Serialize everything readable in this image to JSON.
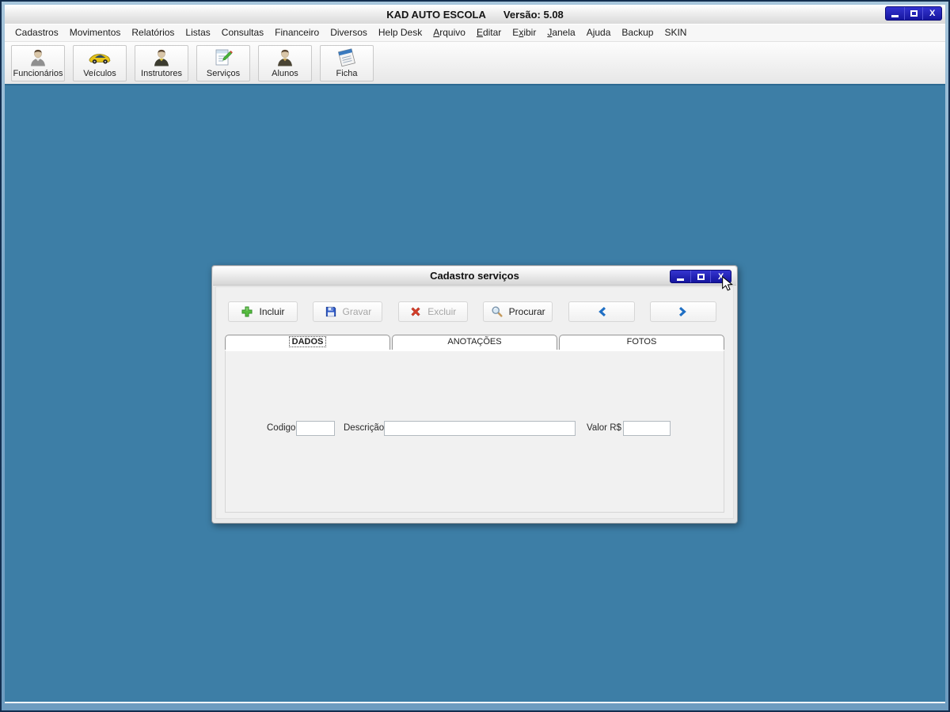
{
  "app": {
    "name": "KAD AUTO ESCOLA",
    "version_label": "Versão: 5.08",
    "window_controls": {
      "minimize_icon": "minimize-icon",
      "maximize_icon": "maximize-icon",
      "close_glyph": "X"
    }
  },
  "menu": {
    "items": [
      {
        "label": "Cadastros"
      },
      {
        "label": "Movimentos"
      },
      {
        "label": "Relatórios"
      },
      {
        "label": "Listas"
      },
      {
        "label": "Consultas"
      },
      {
        "label": "Financeiro"
      },
      {
        "label": "Diversos"
      },
      {
        "label": "Help Desk"
      },
      {
        "label": "Arquivo",
        "underline": 0
      },
      {
        "label": "Editar",
        "underline": 0
      },
      {
        "label": "Exibir",
        "underline": 1
      },
      {
        "label": "Janela",
        "underline": 0
      },
      {
        "label": "Ajuda"
      },
      {
        "label": "Backup"
      },
      {
        "label": "SKIN"
      }
    ]
  },
  "toolbar": {
    "buttons": [
      {
        "label": "Funcionários",
        "icon": "employee-person-icon"
      },
      {
        "label": "Veículos",
        "icon": "car-icon"
      },
      {
        "label": "Instrutores",
        "icon": "instructor-person-icon"
      },
      {
        "label": "Serviços",
        "icon": "document-pencil-icon"
      },
      {
        "label": "Alunos",
        "icon": "student-person-icon"
      },
      {
        "label": "Ficha",
        "icon": "notepad-icon"
      }
    ]
  },
  "dialog": {
    "title": "Cadastro serviços",
    "window_controls": {
      "minimize_icon": "minimize-icon",
      "maximize_icon": "maximize-icon",
      "close_glyph": "X"
    },
    "toolbar_buttons": [
      {
        "label": "Incluir",
        "icon": "plus-icon",
        "enabled": true,
        "width": "w-lg"
      },
      {
        "label": "Gravar",
        "icon": "save-floppy-icon",
        "enabled": false,
        "width": "w-lg"
      },
      {
        "label": "Excluir",
        "icon": "delete-x-icon",
        "enabled": false,
        "width": "w-lg"
      },
      {
        "label": "Procurar",
        "icon": "search-magnifier-icon",
        "enabled": true,
        "width": "w-lg"
      },
      {
        "label": "",
        "icon": "chevron-left-icon",
        "enabled": true,
        "width": "w-nav"
      },
      {
        "label": "",
        "icon": "chevron-right-icon",
        "enabled": true,
        "width": "w-nav"
      }
    ],
    "tabs": [
      {
        "label": "DADOS",
        "active": true
      },
      {
        "label": "ANOTAÇÕES",
        "active": false
      },
      {
        "label": "FOTOS",
        "active": false
      }
    ],
    "fields": [
      {
        "key": "codigo",
        "label": "Codigo",
        "value": ""
      },
      {
        "key": "descricao",
        "label": "Descrição",
        "value": ""
      },
      {
        "key": "valor",
        "label": "Valor R$",
        "value": ""
      }
    ]
  },
  "colors": {
    "desktop_blue": "#3d7ea6",
    "frame_navy": "#16365c",
    "frame_light_blue": "#9dbfd8",
    "window_button_blue": "#1e1eb0",
    "accent_blue": "#1f6fc4",
    "toolbar_separator_teal": "#2d6a92"
  }
}
